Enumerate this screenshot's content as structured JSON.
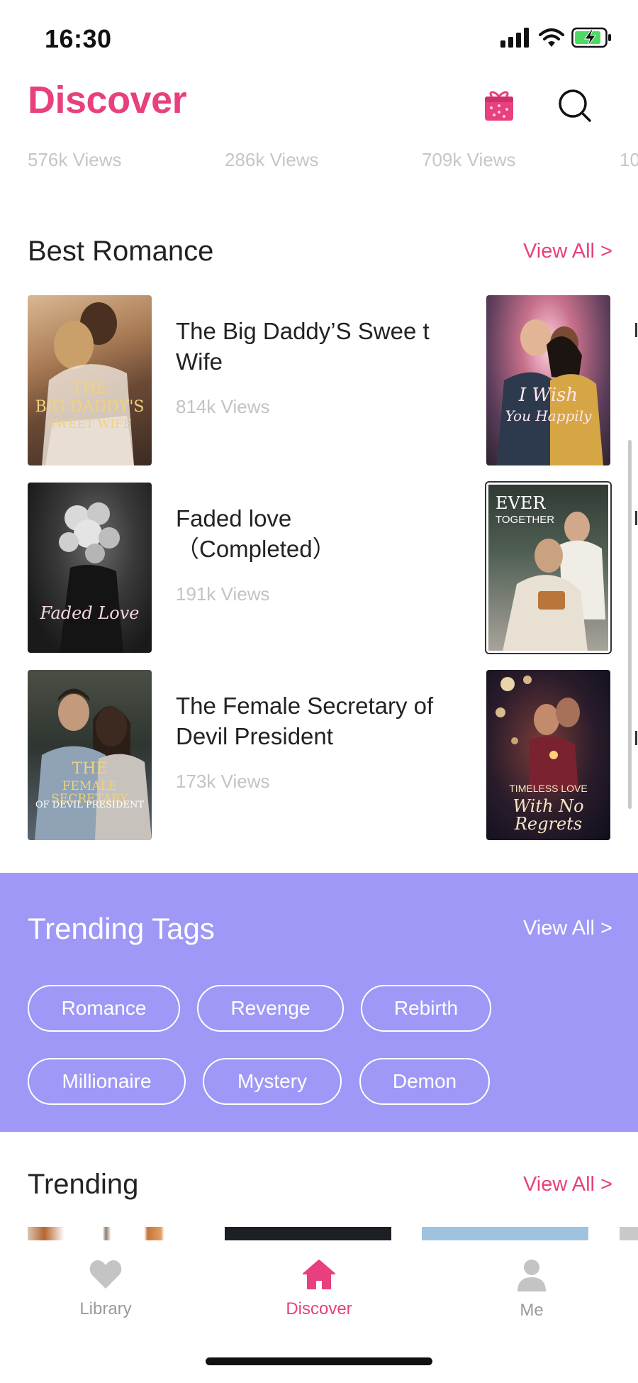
{
  "status": {
    "time": "16:30"
  },
  "header": {
    "title": "Discover"
  },
  "top_views": [
    "576k Views",
    "286k Views",
    "709k Views",
    "10"
  ],
  "best_romance": {
    "title": "Best Romance",
    "view_all": "View All >",
    "books": [
      {
        "title": "The Big Daddy’S Swee t Wife",
        "views": "814k Views",
        "cover_text": [
          "THE",
          "BIG DADDY'S",
          "SWEET WIFE"
        ]
      },
      {
        "title": "Faded love （Completed）",
        "views": "191k Views",
        "cover_text": [
          "Faded Love"
        ]
      },
      {
        "title": "The Female Secretary of Devil President",
        "views": "173k Views",
        "cover_text": [
          "THE",
          "FEMALE SECRETARY",
          "OF DEVIL PRESIDENT"
        ]
      }
    ],
    "side_covers": [
      {
        "lines": [
          "I Wish",
          "You Happily"
        ]
      },
      {
        "lines": [
          "EVER",
          "TOGETHER"
        ]
      },
      {
        "lines": [
          "TIMELESS LOVE",
          "With No Regrets"
        ]
      }
    ]
  },
  "trending_tags": {
    "title": "Trending Tags",
    "view_all": "View All >",
    "tags": [
      "Romance",
      "Revenge",
      "Rebirth",
      "Millionaire",
      "Mystery",
      "Demon"
    ]
  },
  "trending": {
    "title": "Trending",
    "view_all": "View All >"
  },
  "tab_bar": {
    "items": [
      {
        "label": "Library",
        "icon": "heart-icon",
        "active": false
      },
      {
        "label": "Discover",
        "icon": "home-icon",
        "active": true
      },
      {
        "label": "Me",
        "icon": "person-icon",
        "active": false
      }
    ]
  },
  "colors": {
    "accent": "#e8407e",
    "tags_band": "#9f98f7",
    "muted": "#c3c3c3"
  }
}
